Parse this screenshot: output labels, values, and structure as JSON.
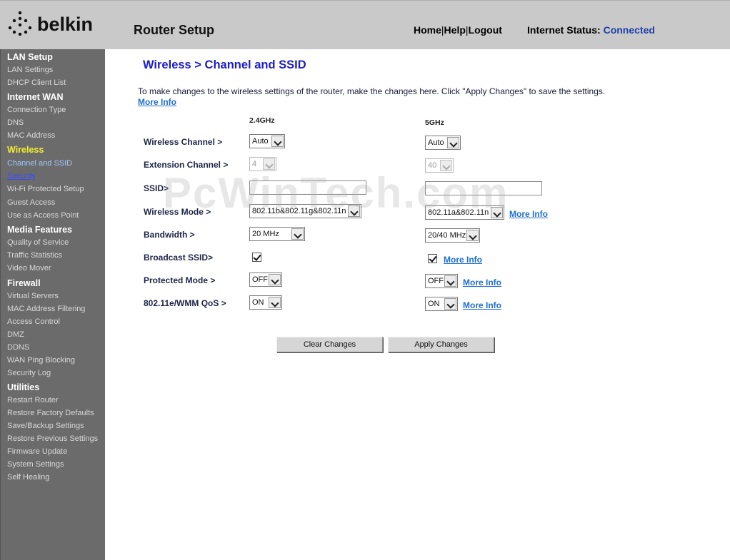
{
  "header": {
    "brand": "belkin",
    "title": "Router Setup",
    "nav": {
      "home": "Home",
      "help": "Help",
      "logout": "Logout"
    },
    "status_label": "Internet Status:",
    "status_value": "Connected"
  },
  "sidebar": {
    "sections": [
      {
        "heading": "LAN Setup",
        "items": [
          "LAN Settings",
          "DHCP Client List"
        ]
      },
      {
        "heading": "Internet WAN",
        "items": [
          "Connection Type",
          "DNS",
          "MAC Address"
        ]
      },
      {
        "heading": "Wireless",
        "items": [
          "Channel and SSID",
          "Security",
          "Wi-Fi Protected Setup",
          "Guest Access",
          "Use as Access Point"
        ]
      },
      {
        "heading": "Media Features",
        "items": [
          "Quality of Service",
          "Traffic Statistics",
          "Video Mover"
        ]
      },
      {
        "heading": "Firewall",
        "items": [
          "Virtual Servers",
          "MAC Address Filtering",
          "Access Control",
          "DMZ",
          "DDNS",
          "WAN Ping Blocking",
          "Security Log"
        ]
      },
      {
        "heading": "Utilities",
        "items": [
          "Restart Router",
          "Restore Factory Defaults",
          "Save/Backup Settings",
          "Restore Previous Settings",
          "Firmware Update",
          "System Settings",
          "Self Healing"
        ]
      }
    ]
  },
  "main": {
    "title": "Wireless > Channel and SSID",
    "intro": "To make changes to the wireless settings of the router, make the changes here. Click \"Apply Changes\" to save the settings.",
    "more_info": "More Info",
    "band_24": "2.4GHz",
    "band_5": "5GHz",
    "labels": {
      "channel": "Wireless Channel >",
      "extension": "Extension Channel >",
      "ssid": "SSID>",
      "mode": "Wireless Mode >",
      "bandwidth": "Bandwidth >",
      "broadcast": "Broadcast SSID>",
      "protected": "Protected Mode >",
      "qos": "802.11e/WMM QoS >"
    },
    "g24": {
      "channel": "Auto",
      "extension": "4",
      "ssid": "",
      "mode": "802.11b&802.11g&802.11n",
      "bandwidth": "20 MHz",
      "broadcast": true,
      "protected": "OFF",
      "qos": "ON"
    },
    "g5": {
      "channel": "Auto",
      "extension": "40",
      "ssid": "",
      "mode": "802.11a&802.11n",
      "bandwidth": "20/40 MHz",
      "broadcast": true,
      "protected": "OFF",
      "qos": "ON"
    },
    "buttons": {
      "clear": "Clear Changes",
      "apply": "Apply Changes"
    },
    "watermark": "PcWinTech.com"
  }
}
